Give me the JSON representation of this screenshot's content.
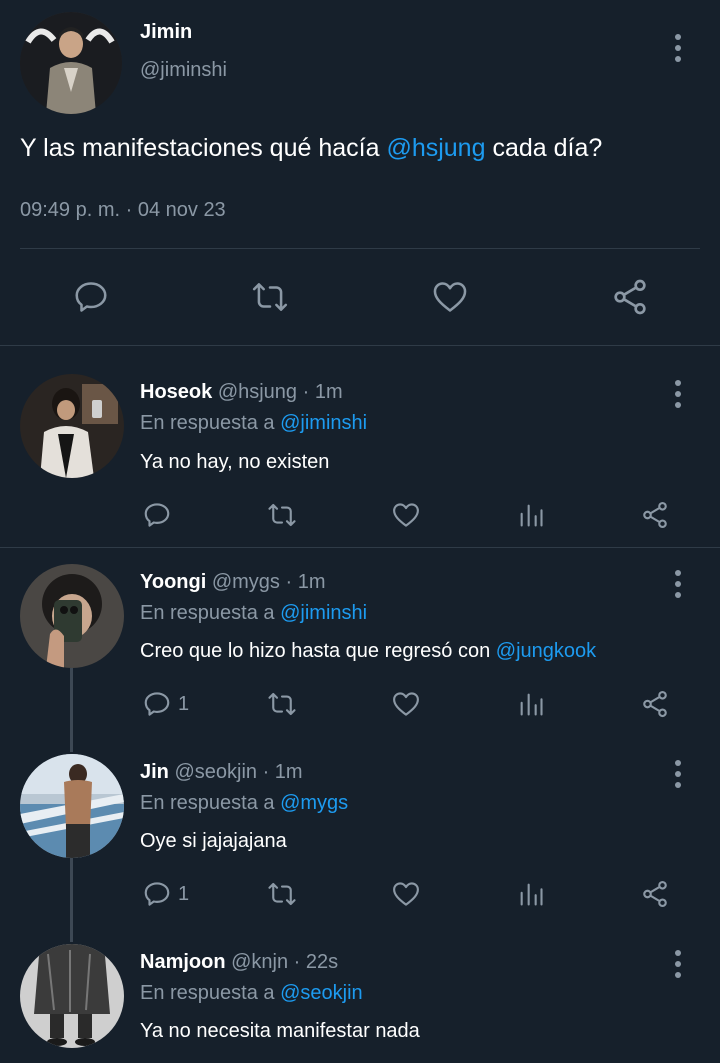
{
  "main_tweet": {
    "display_name": "Jimin",
    "handle": "@jiminshi",
    "text_before": "Y las manifestaciones qué hacía ",
    "mention": "@hsjung",
    "text_after": " cada día?",
    "timestamp": "09:49 p. m. · 04 nov 23"
  },
  "replies": [
    {
      "display_name": "Hoseok",
      "meta": "@hsjung · 1m",
      "reply_prefix": "En respuesta a",
      "reply_to": "@jiminshi",
      "text": "Ya no hay, no existen",
      "mention": "",
      "reply_count": ""
    },
    {
      "display_name": "Yoongi",
      "meta": "@mygs · 1m",
      "reply_prefix": "En respuesta a",
      "reply_to": "@jiminshi",
      "text": "Creo que lo hizo hasta que regresó con ",
      "mention": "@jungkook",
      "reply_count": "1"
    },
    {
      "display_name": "Jin",
      "meta": "@seokjin · 1m",
      "reply_prefix": "En respuesta a",
      "reply_to": "@mygs",
      "text": "Oye si jajajajana",
      "mention": "",
      "reply_count": "1"
    },
    {
      "display_name": "Namjoon",
      "meta": "@knjn · 22s",
      "reply_prefix": "En respuesta a",
      "reply_to": "@seokjin",
      "text": "Ya no necesita manifestar nada",
      "mention": "",
      "reply_count": ""
    }
  ],
  "icons": {
    "reply": "speech-bubble-icon",
    "retweet": "retweet-icon",
    "like": "heart-icon",
    "views": "bar-chart-icon",
    "share": "share-icon",
    "more": "more-vertical-icon"
  },
  "colors": {
    "background": "#16202b",
    "text": "#ffffff",
    "muted": "#8b98a5",
    "link": "#1d9bf0",
    "divider": "#2f3b47"
  }
}
